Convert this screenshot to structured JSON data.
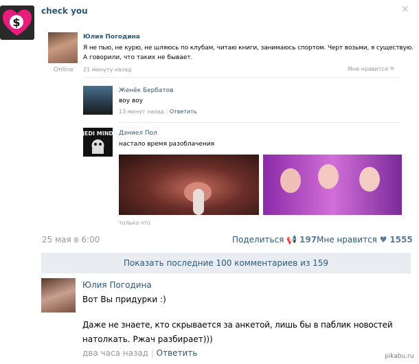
{
  "post": {
    "author": "check you",
    "repost": {
      "author": "Юлия Погодина",
      "text_line1": "Я не пью, не курю, не шляюсь по клубам, читаю книги, занимаюсь спортом. Черт возьми, я существую.",
      "text_line2": "А говорили, что таких не бывает.",
      "online": "Online",
      "time": "21 минуту назад",
      "like": "Мне нравится"
    },
    "comments": [
      {
        "author": "Женёк Бербатов",
        "text": "воу воу",
        "time": "13 минут назад",
        "reply": "Ответить"
      },
      {
        "author": "Дэниел Пол",
        "text": "настало время разоблачения",
        "caption": "только что"
      }
    ],
    "date": "25 мая в 6:00",
    "share": "Поделиться",
    "share_count": "197",
    "likes": "Мне нравится",
    "likes_count": "1555"
  },
  "show_more": "Показать последние 100 комментариев из 159",
  "comment": {
    "author": "Юлия Погодина",
    "line1": "Вот Вы придурки :)",
    "line2": "Даже не знаете, кто скрывается за анкетой, лишь бы в паблик новостей",
    "line3": "натолкать. Ржач разбирает)))",
    "time": "два часа назад",
    "reply": "Ответить"
  },
  "watermark": "pikabu.ru"
}
